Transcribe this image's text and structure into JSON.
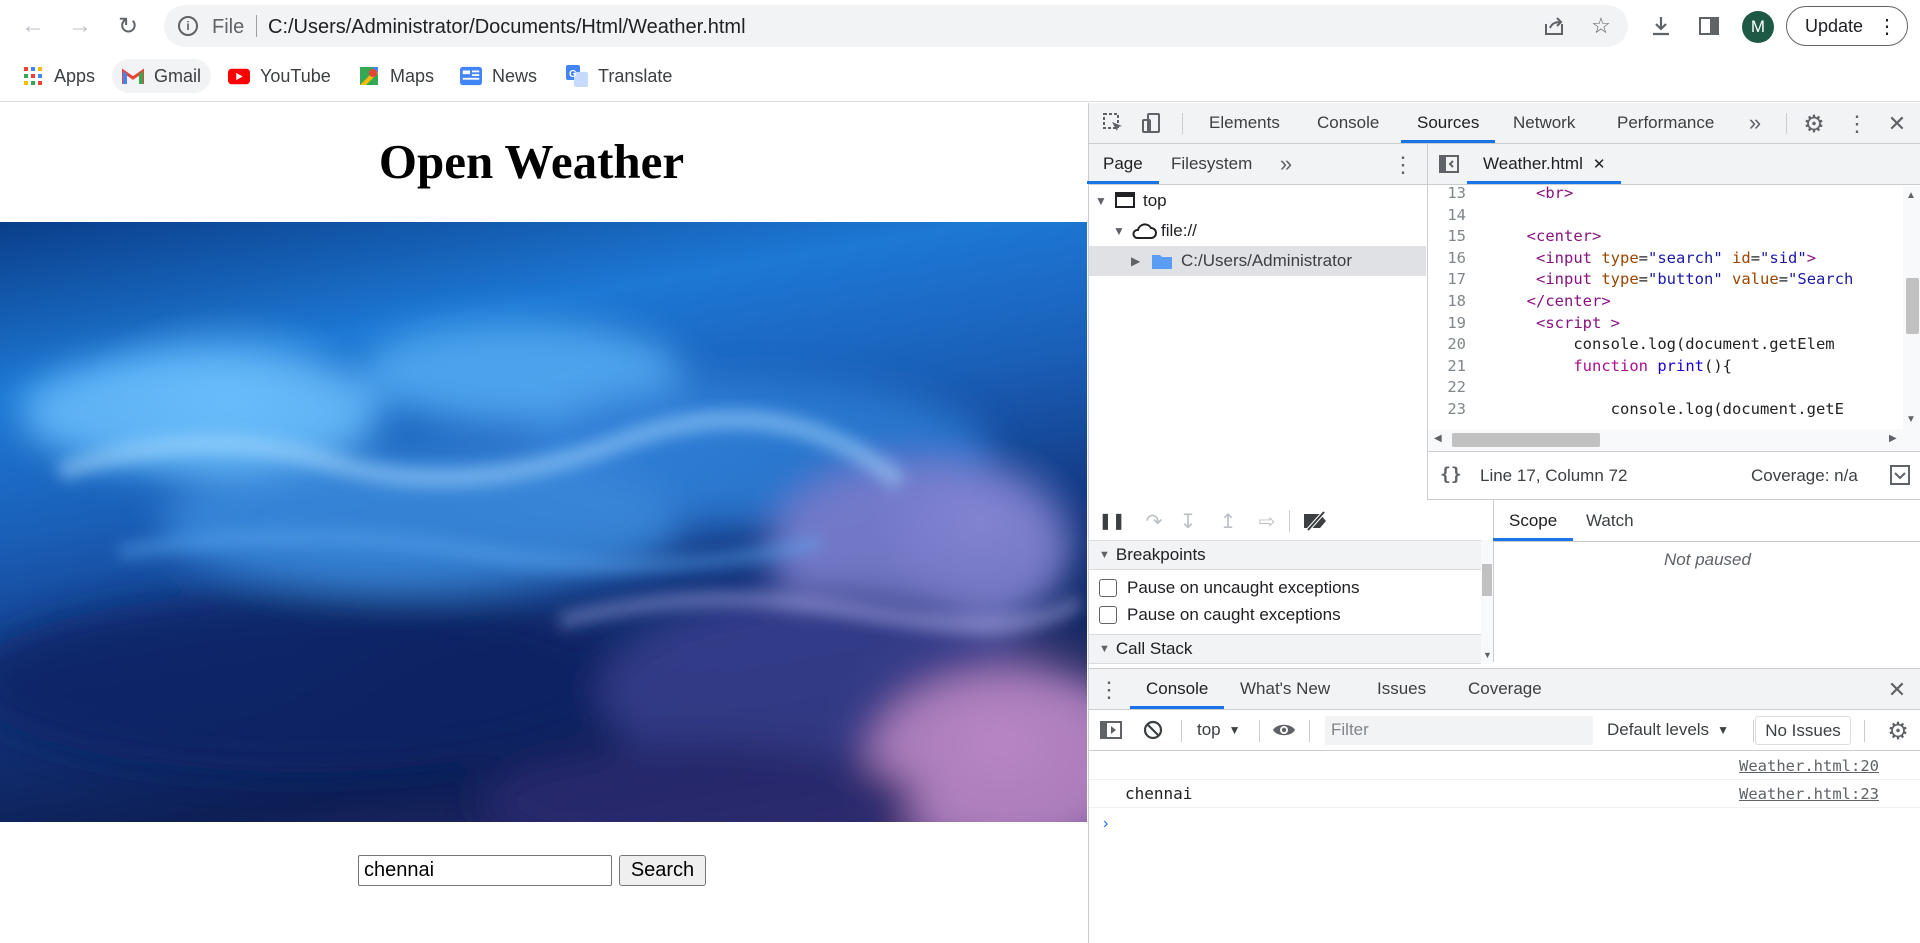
{
  "browser": {
    "scheme": "File",
    "url": "C:/Users/Administrator/Documents/Html/Weather.html",
    "avatar_letter": "M",
    "update_label": "Update",
    "bookmarks": [
      {
        "label": "Apps",
        "icon": "apps-grid-icon"
      },
      {
        "label": "Gmail",
        "icon": "gmail-icon"
      },
      {
        "label": "YouTube",
        "icon": "youtube-icon"
      },
      {
        "label": "Maps",
        "icon": "maps-icon"
      },
      {
        "label": "News",
        "icon": "news-icon"
      },
      {
        "label": "Translate",
        "icon": "translate-icon"
      }
    ]
  },
  "page": {
    "title": "Open Weather",
    "search_value": "chennai",
    "search_button": "Search"
  },
  "devtools": {
    "tabs": [
      "Elements",
      "Console",
      "Sources",
      "Network",
      "Performance"
    ],
    "active_tab": "Sources",
    "nav_tabs": [
      "Page",
      "Filesystem"
    ],
    "tree": [
      {
        "label": "top",
        "icon": "frame-icon"
      },
      {
        "label": "file://",
        "icon": "cloud-icon"
      },
      {
        "label": "C:/Users/Administrator",
        "icon": "folder-icon"
      }
    ],
    "file_tab": "Weather.html",
    "code_lines": [
      {
        "n": "13",
        "html": "      <span class='tag'>&lt;br&gt;</span>"
      },
      {
        "n": "14",
        "html": ""
      },
      {
        "n": "15",
        "html": "     <span class='tag'>&lt;center&gt;</span>"
      },
      {
        "n": "16",
        "html": "      <span class='tag'>&lt;input</span> <span class='attr'>type</span>=<span class='val'>\"search\"</span> <span class='attr'>id</span>=<span class='val'>\"sid\"</span><span class='tag'>&gt;</span>"
      },
      {
        "n": "17",
        "html": "      <span class='tag'>&lt;input</span> <span class='attr'>type</span>=<span class='val'>\"button\"</span> <span class='attr'>value</span>=<span class='val'>\"Search</span>"
      },
      {
        "n": "18",
        "html": "     <span class='tag'>&lt;/center&gt;</span>"
      },
      {
        "n": "19",
        "html": "      <span class='tag'>&lt;script</span> <span class='tag'>&gt;</span>"
      },
      {
        "n": "20",
        "html": "          <span class='txt'>console.log(document.getElem</span>"
      },
      {
        "n": "21",
        "html": "          <span class='kw'>function</span> <span class='fn'>print</span><span class='txt'>(){</span>"
      },
      {
        "n": "22",
        "html": ""
      },
      {
        "n": "23",
        "html": "              <span class='txt'>console.log(document.getE</span>"
      }
    ],
    "status": {
      "position": "Line 17, Column 72",
      "coverage": "Coverage: n/a"
    },
    "scope_tabs": [
      "Scope",
      "Watch"
    ],
    "not_paused": "Not paused",
    "breakpoints_title": "Breakpoints",
    "pause_uncaught": "Pause on uncaught exceptions",
    "pause_caught": "Pause on caught exceptions",
    "call_stack_title": "Call Stack",
    "drawer_tabs": [
      "Console",
      "What's New",
      "Issues",
      "Coverage"
    ],
    "console_context": "top",
    "filter_placeholder": "Filter",
    "default_levels": "Default levels",
    "no_issues": "No Issues",
    "console_messages": [
      {
        "text": "",
        "source": "Weather.html:20"
      },
      {
        "text": "chennai",
        "source": "Weather.html:23"
      }
    ]
  }
}
